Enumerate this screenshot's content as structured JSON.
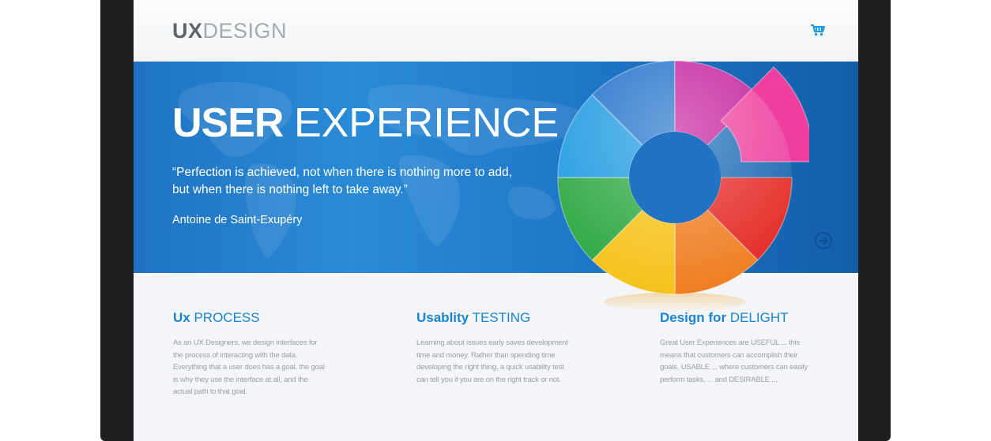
{
  "header": {
    "logo_bold": "UX",
    "logo_light": "DESIGN",
    "cart_icon": "shopping-cart-icon"
  },
  "hero": {
    "title_bold": "USER",
    "title_light": "EXPERIENCE",
    "quote": "“Perfection is achieved, not when there is nothing more to add, but when there is nothing left to take away.”",
    "author": "Antoine de Saint-Exupéry",
    "next_icon": "arrow-right-circle-icon",
    "graphic_icon": "color-wheel-icon"
  },
  "features": [
    {
      "title_bold": "Ux",
      "title_light": "PROCESS",
      "text": "As an UX Designers, we design interfaces for the process of interacting with the data. Everything that a user does has a goal, the goal is why they use the interface at all, and the actual path to that goal."
    },
    {
      "title_bold": "Usablity",
      "title_light": "TESTING",
      "text": "Learning about issues early saves development time and money. Rather than spending time developing the right thing, a quick usability test can tell you if you are on the right track or not."
    },
    {
      "title_bold": "Design for",
      "title_light": "DELIGHT",
      "text": "Great User Experiences are USEFUL ... this means that customers can accomplish their goals, USABLE ... where customers can easily perform tasks, ... and DESIRABLE ..."
    }
  ],
  "colors": {
    "hero_blue": "#1f78c8",
    "accent_blue": "#1a84cf",
    "wheel": [
      "#1e6fc9",
      "#c41c9c",
      "#ee3f9f",
      "#e42a26",
      "#f07e22",
      "#f6c21b",
      "#2ea843",
      "#1d9ae0"
    ]
  }
}
